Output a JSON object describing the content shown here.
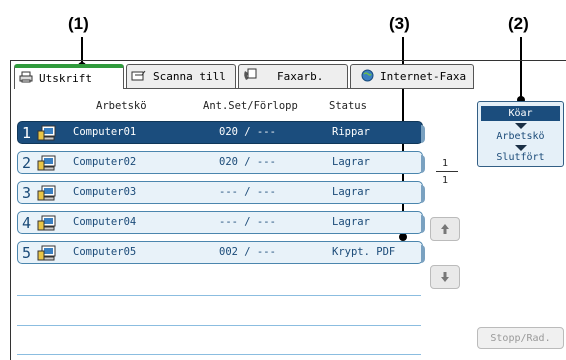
{
  "callouts": [
    "(1)",
    "(2)",
    "(3)"
  ],
  "tabs": [
    {
      "label": "Utskrift",
      "icon": "printer-icon"
    },
    {
      "label": "Scanna till",
      "icon": "scan-icon"
    },
    {
      "label": "Faxarb.",
      "icon": "fax-icon"
    },
    {
      "label": "Internet-Faxa",
      "icon": "globe-icon"
    }
  ],
  "columns": {
    "job": "Arbetskö",
    "sets": "Ant.Set/Förlopp",
    "status": "Status"
  },
  "jobs": [
    {
      "num": "1",
      "name": "Computer01",
      "sets": "020 / ---",
      "status": "Rippar"
    },
    {
      "num": "2",
      "name": "Computer02",
      "sets": "020 / ---",
      "status": "Lagrar"
    },
    {
      "num": "3",
      "name": "Computer03",
      "sets": "--- / ---",
      "status": "Lagrar"
    },
    {
      "num": "4",
      "name": "Computer04",
      "sets": "--- / ---",
      "status": "Lagrar"
    },
    {
      "num": "5",
      "name": "Computer05",
      "sets": "002 / ---",
      "status": "Krypt. PDF"
    }
  ],
  "pagination": {
    "current": "1",
    "total": "1"
  },
  "mode": {
    "active": "Köar",
    "middle": "Arbetskö",
    "bottom": "Slutfört"
  },
  "stop_button": "Stopp/Rad.",
  "colors": {
    "selected_row": "#1b4d7d",
    "row_bg": "#e8f2f9",
    "active_tab_accent": "#2f9a3c"
  }
}
